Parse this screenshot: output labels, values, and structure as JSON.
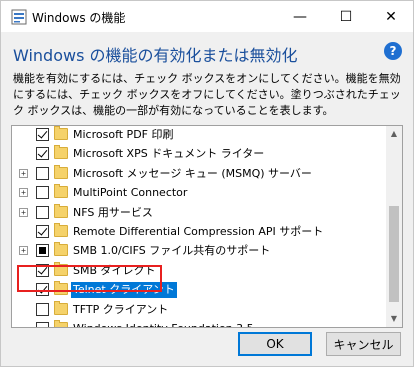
{
  "window": {
    "title": "Windows の機能",
    "controls": {
      "minimize": "—",
      "maximize": "☐",
      "close": "✕"
    }
  },
  "header": {
    "title": "Windows の機能の有効化または無効化",
    "help": "?"
  },
  "description": "機能を有効にするには、チェック ボックスをオンにしてください。機能を無効にするには、チェック ボックスをオフにしてください。塗りつぶされたチェック ボックスは、機能の一部が有効になっていることを表します。",
  "features": [
    {
      "label": "Microsoft PDF 印刷",
      "state": "checked",
      "expandable": false
    },
    {
      "label": "Microsoft XPS ドキュメント ライター",
      "state": "checked",
      "expandable": false
    },
    {
      "label": "Microsoft メッセージ キュー (MSMQ) サーバー",
      "state": "unchecked",
      "expandable": true
    },
    {
      "label": "MultiPoint Connector",
      "state": "unchecked",
      "expandable": true
    },
    {
      "label": "NFS 用サービス",
      "state": "unchecked",
      "expandable": true
    },
    {
      "label": "Remote Differential Compression API サポート",
      "state": "checked",
      "expandable": false
    },
    {
      "label": "SMB 1.0/CIFS ファイル共有のサポート",
      "state": "partial",
      "expandable": true
    },
    {
      "label": "SMB ダイレクト",
      "state": "checked",
      "expandable": false
    },
    {
      "label": "Telnet クライアント",
      "state": "checked",
      "expandable": false,
      "selected": true
    },
    {
      "label": "TFTP クライアント",
      "state": "unchecked",
      "expandable": false
    },
    {
      "label": "Windows Identity Foundation 3.5",
      "state": "unchecked",
      "expandable": false
    }
  ],
  "buttons": {
    "ok": "OK",
    "cancel": "キャンセル"
  },
  "colors": {
    "accent": "#0078d7",
    "heading": "#1a4f9c",
    "highlight": "#e8201f",
    "folder": "#f5d26a"
  }
}
